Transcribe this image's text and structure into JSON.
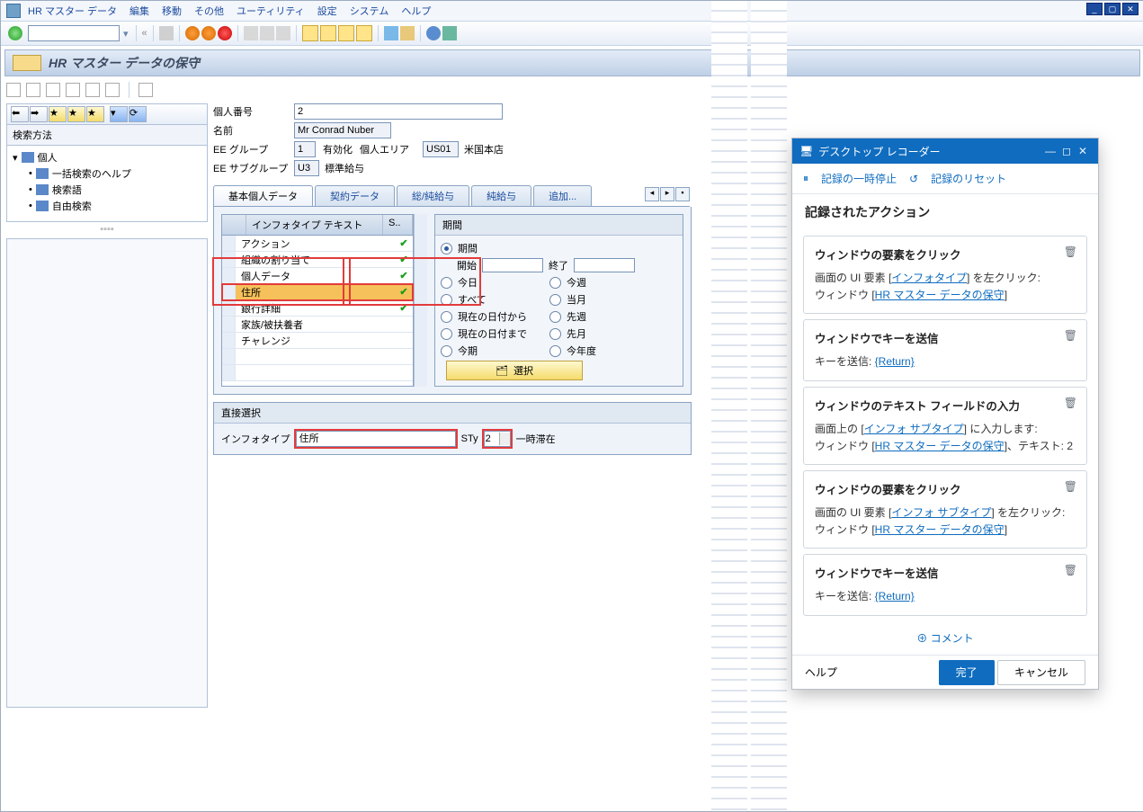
{
  "menu": {
    "items": [
      "HR マスター データ",
      "編集",
      "移動",
      "その他",
      "ユーティリティ",
      "設定",
      "システム",
      "ヘルプ"
    ]
  },
  "title": "HR マスター データの保守",
  "tree": {
    "root": "個人",
    "header": "検索方法",
    "items": [
      "一括検索のヘルプ",
      "検索語",
      "自由検索"
    ]
  },
  "form": {
    "f1": {
      "label": "個人番号",
      "value": "2"
    },
    "f2": {
      "label": "名前",
      "value": "Mr Conrad Nuber"
    },
    "f3": {
      "label": "EE グループ",
      "code": "1",
      "text": "有効化",
      "area_label": "個人エリア",
      "area_code": "US01",
      "area_text": "米国本店"
    },
    "f4": {
      "label": "EE サブグループ",
      "code": "U3",
      "text": "標準給与"
    }
  },
  "tabs": [
    "基本個人データ",
    "契約データ",
    "総/純給与",
    "純給与",
    "追加..."
  ],
  "info": {
    "hdr1": "インフォタイプ テキスト",
    "hdr2": "S..",
    "rows": [
      {
        "t": "アクション",
        "c": true
      },
      {
        "t": "組織の割り当て",
        "c": true
      },
      {
        "t": "個人データ",
        "c": true
      },
      {
        "t": "住所",
        "c": true,
        "hi": true
      },
      {
        "t": "銀行詳細",
        "c": true
      },
      {
        "t": "家族/被扶養者",
        "c": false
      },
      {
        "t": "チャレンジ",
        "c": false
      }
    ]
  },
  "period": {
    "title": "期間",
    "r_period": "期間",
    "start": "開始",
    "end": "終了",
    "r_today": "今日",
    "r_thisweek": "今週",
    "r_all": "すべて",
    "r_thismonth": "当月",
    "r_fromtoday": "現在の日付から",
    "r_lastweek": "先週",
    "r_totoday": "現在の日付まで",
    "r_lastmonth": "先月",
    "r_curper": "今期",
    "r_curyr": "今年度",
    "select_btn": "選択"
  },
  "direct": {
    "title": "直接選択",
    "infotype_label": "インフォタイプ",
    "infotype_value": "住所",
    "sty_label": "STy",
    "sty_value": "2",
    "sty_text": "一時滞在"
  },
  "recorder": {
    "title": "デスクトップ レコーダー",
    "pause": "記録の一時停止",
    "reset": "記録のリセット",
    "section": "記録されたアクション",
    "cards": [
      {
        "t": "ウィンドウの要素をクリック",
        "b1": "画面の UI 要素 [",
        "l1": "インフォタイプ",
        "b2": "] を左クリック:",
        "b3": "ウィンドウ [",
        "l2": "HR マスター データの保守",
        "b4": "]"
      },
      {
        "t": "ウィンドウでキーを送信",
        "k": "キーを送信: ",
        "kv": "{Return}"
      },
      {
        "t": "ウィンドウのテキスト フィールドの入力",
        "b1": "画面上の [",
        "l1": "インフォ サブタイプ",
        "b2": "] に入力します:",
        "b3": "ウィンドウ [",
        "l2": "HR マスター データの保守",
        "b4": "]、テキスト: 2"
      },
      {
        "t": "ウィンドウの要素をクリック",
        "b1": "画面の UI 要素 [",
        "l1": "インフォ サブタイプ",
        "b2": "] を左クリック:",
        "b3": "ウィンドウ [",
        "l2": "HR マスター データの保守",
        "b4": "]"
      },
      {
        "t": "ウィンドウでキーを送信",
        "k": "キーを送信: ",
        "kv": "{Return}"
      }
    ],
    "comment": "コメント",
    "help": "ヘルプ",
    "done": "完了",
    "cancel": "キャンセル"
  }
}
